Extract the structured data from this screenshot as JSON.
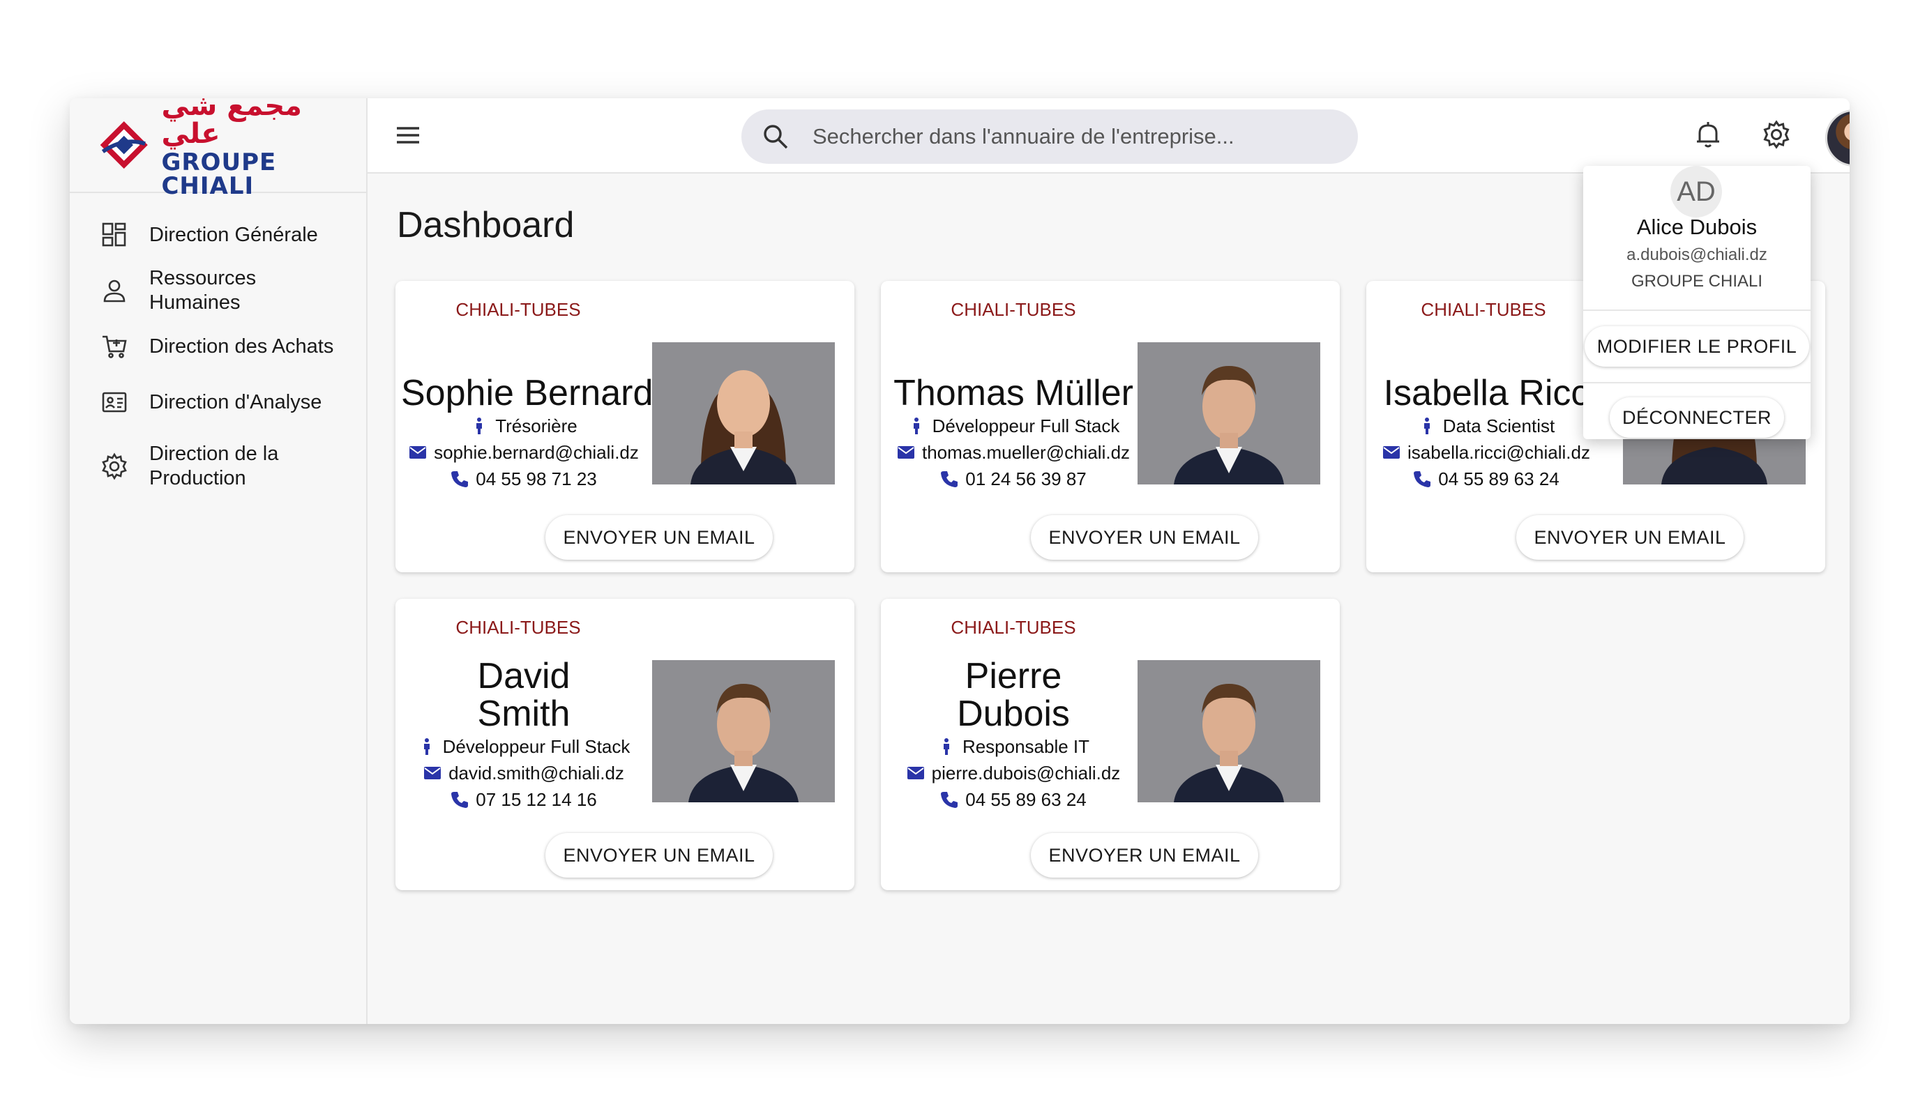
{
  "brand": {
    "arabic": "مجمع شي علي",
    "name": "GROUPE CHIALI"
  },
  "sidebar": {
    "items": [
      {
        "label": "Direction Générale",
        "icon": "dashboard-icon"
      },
      {
        "label": "Ressources Humaines",
        "icon": "person-icon"
      },
      {
        "label": "Direction des Achats",
        "icon": "cart-icon"
      },
      {
        "label": "Direction d'Analyse",
        "icon": "analytics-icon"
      },
      {
        "label": "Direction de la Production",
        "icon": "gear-icon"
      }
    ]
  },
  "search": {
    "placeholder": "Sechercher dans l'annuaire de l'entreprise..."
  },
  "main": {
    "title": "Dashboard"
  },
  "cards": [
    {
      "company": "CHIALI-TUBES",
      "name": "Sophie Bernard",
      "role": "Trésorière",
      "email": "sophie.bernard@chiali.dz",
      "phone": "04 55 98 71 23",
      "button": "ENVOYER UN EMAIL"
    },
    {
      "company": "CHIALI-TUBES",
      "name": "Thomas Müller",
      "role": "Développeur Full Stack",
      "email": "thomas.mueller@chiali.dz",
      "phone": "01 24 56 39 87",
      "button": "ENVOYER UN EMAIL"
    },
    {
      "company": "CHIALI-TUBES",
      "name": "Isabella Ricc",
      "role": "Data Scientist",
      "email": "isabella.ricci@chiali.dz",
      "phone": "04 55 89 63 24",
      "button": "ENVOYER UN EMAIL"
    },
    {
      "company": "CHIALI-TUBES",
      "name_line1": "David",
      "name_line2": "Smith",
      "role": "Développeur Full Stack",
      "email": "david.smith@chiali.dz",
      "phone": "07 15 12 14 16",
      "button": "ENVOYER UN EMAIL"
    },
    {
      "company": "CHIALI-TUBES",
      "name_line1": "Pierre",
      "name_line2": "Dubois",
      "role": "Responsable IT",
      "email": "pierre.dubois@chiali.dz",
      "phone": "04 55 89 63 24",
      "button": "ENVOYER UN EMAIL"
    }
  ],
  "profile_menu": {
    "initials": "AD",
    "name": "Alice Dubois",
    "email": "a.dubois@chiali.dz",
    "company": "GROUPE CHIALI",
    "edit_label": "MODIFIER LE PROFIL",
    "logout_label": "DÉCONNECTER"
  },
  "colors": {
    "company": "#8b1a1a",
    "icon_blue": "#2a34a8",
    "accent": "#1e88e5",
    "brand_red": "#c8102e",
    "brand_blue": "#1f3a8a"
  }
}
